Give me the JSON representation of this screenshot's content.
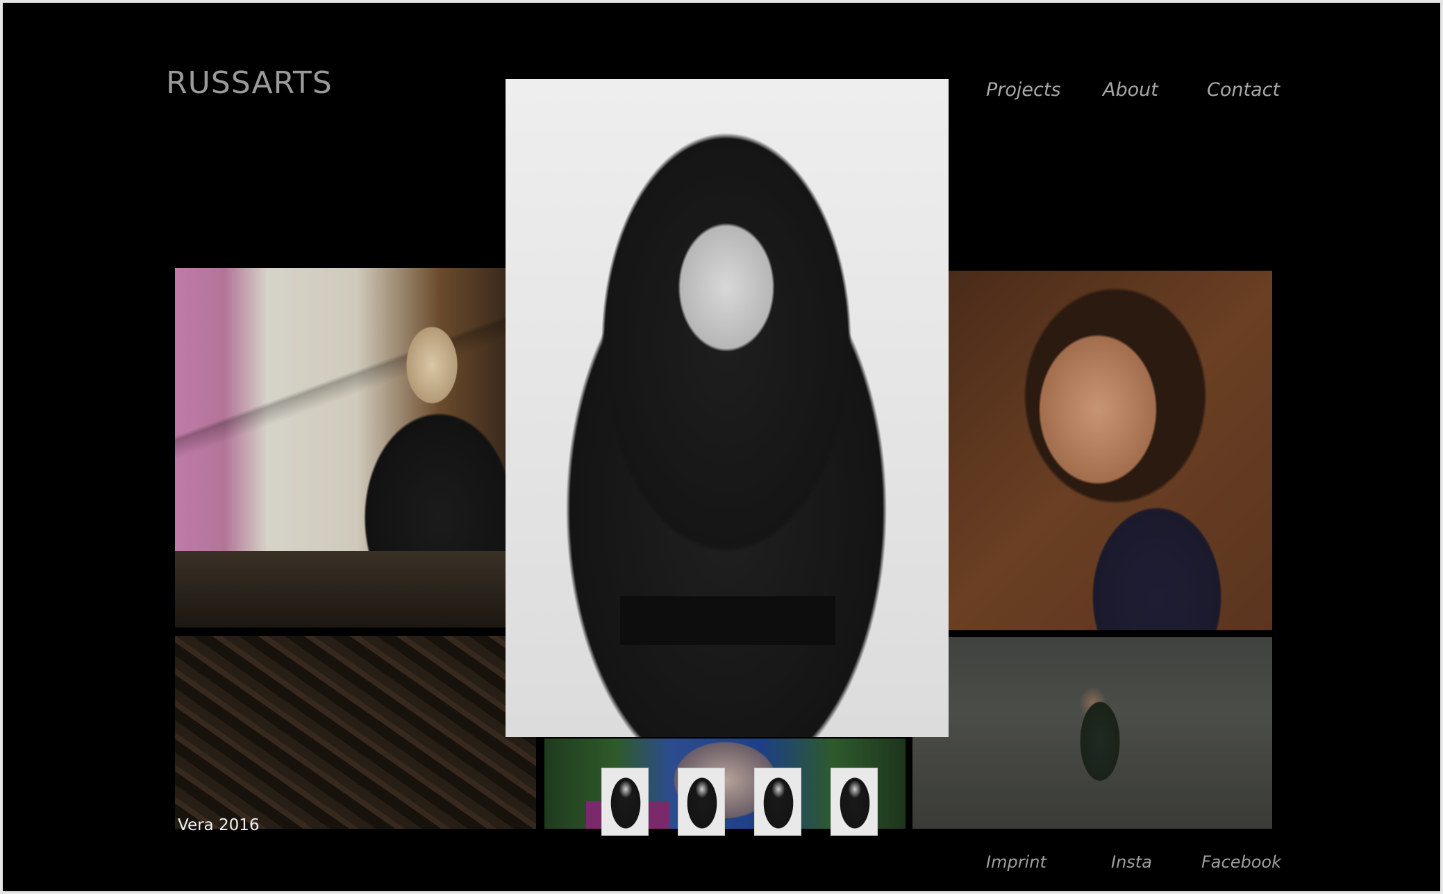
{
  "brand": {
    "logo_text": "RUSSARTS"
  },
  "nav": {
    "items": [
      {
        "label": "Projects"
      },
      {
        "label": "About"
      },
      {
        "label": "Contact"
      }
    ]
  },
  "gallery": {
    "caption": "Vera 2016",
    "thumbnail_count": 4
  },
  "footer": {
    "links": [
      {
        "label": "Imprint"
      },
      {
        "label": "Insta"
      },
      {
        "label": "Facebook"
      }
    ]
  },
  "colors": {
    "background": "#000000",
    "nav_text": "#a8a8a8",
    "logo_text": "#9a9a9a",
    "caption_text": "#f0f0f0"
  }
}
